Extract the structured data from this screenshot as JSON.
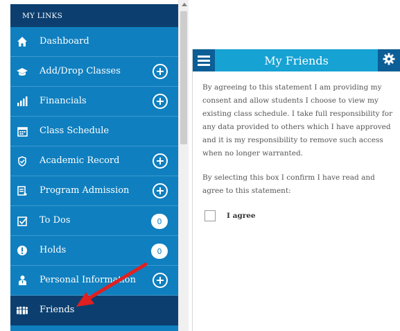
{
  "sidebar": {
    "header": "MY LINKS",
    "items": [
      {
        "label": "Dashboard",
        "icon": "home-icon",
        "action": "none"
      },
      {
        "label": "Add/Drop Classes",
        "icon": "graduation-cap-icon",
        "action": "expand"
      },
      {
        "label": "Financials",
        "icon": "bar-chart-icon",
        "action": "expand"
      },
      {
        "label": "Class Schedule",
        "icon": "calendar-icon",
        "action": "none"
      },
      {
        "label": "Academic Record",
        "icon": "academic-record-icon",
        "action": "expand"
      },
      {
        "label": "Program Admission",
        "icon": "clipboard-icon",
        "action": "expand"
      },
      {
        "label": "To Dos",
        "icon": "checkbox-icon",
        "action": "badge",
        "badge": "0"
      },
      {
        "label": "Holds",
        "icon": "alert-icon",
        "action": "badge",
        "badge": "0"
      },
      {
        "label": "Personal Information",
        "icon": "person-icon",
        "action": "expand"
      },
      {
        "label": "Friends",
        "icon": "friends-icon",
        "action": "none",
        "active": true
      }
    ]
  },
  "panel": {
    "title": "My Friends",
    "paragraph1": "By agreeing to this statement I am providing my consent and allow students I choose to view my existing class schedule. I take full responsibility for any data provided to others which I have approved and it is my responsibility to remove such access when no longer warranted.",
    "paragraph2": "By selecting this box I confirm I have read and agree to this statement:",
    "checkbox_label": "I agree",
    "checked": false
  },
  "colors": {
    "sidebar_bg": "#0f7fbf",
    "sidebar_dark": "#0c3f6f",
    "panel_header": "#16a2d3",
    "panel_header_buttons": "#0c5e96",
    "annotation_arrow": "#e02020"
  }
}
